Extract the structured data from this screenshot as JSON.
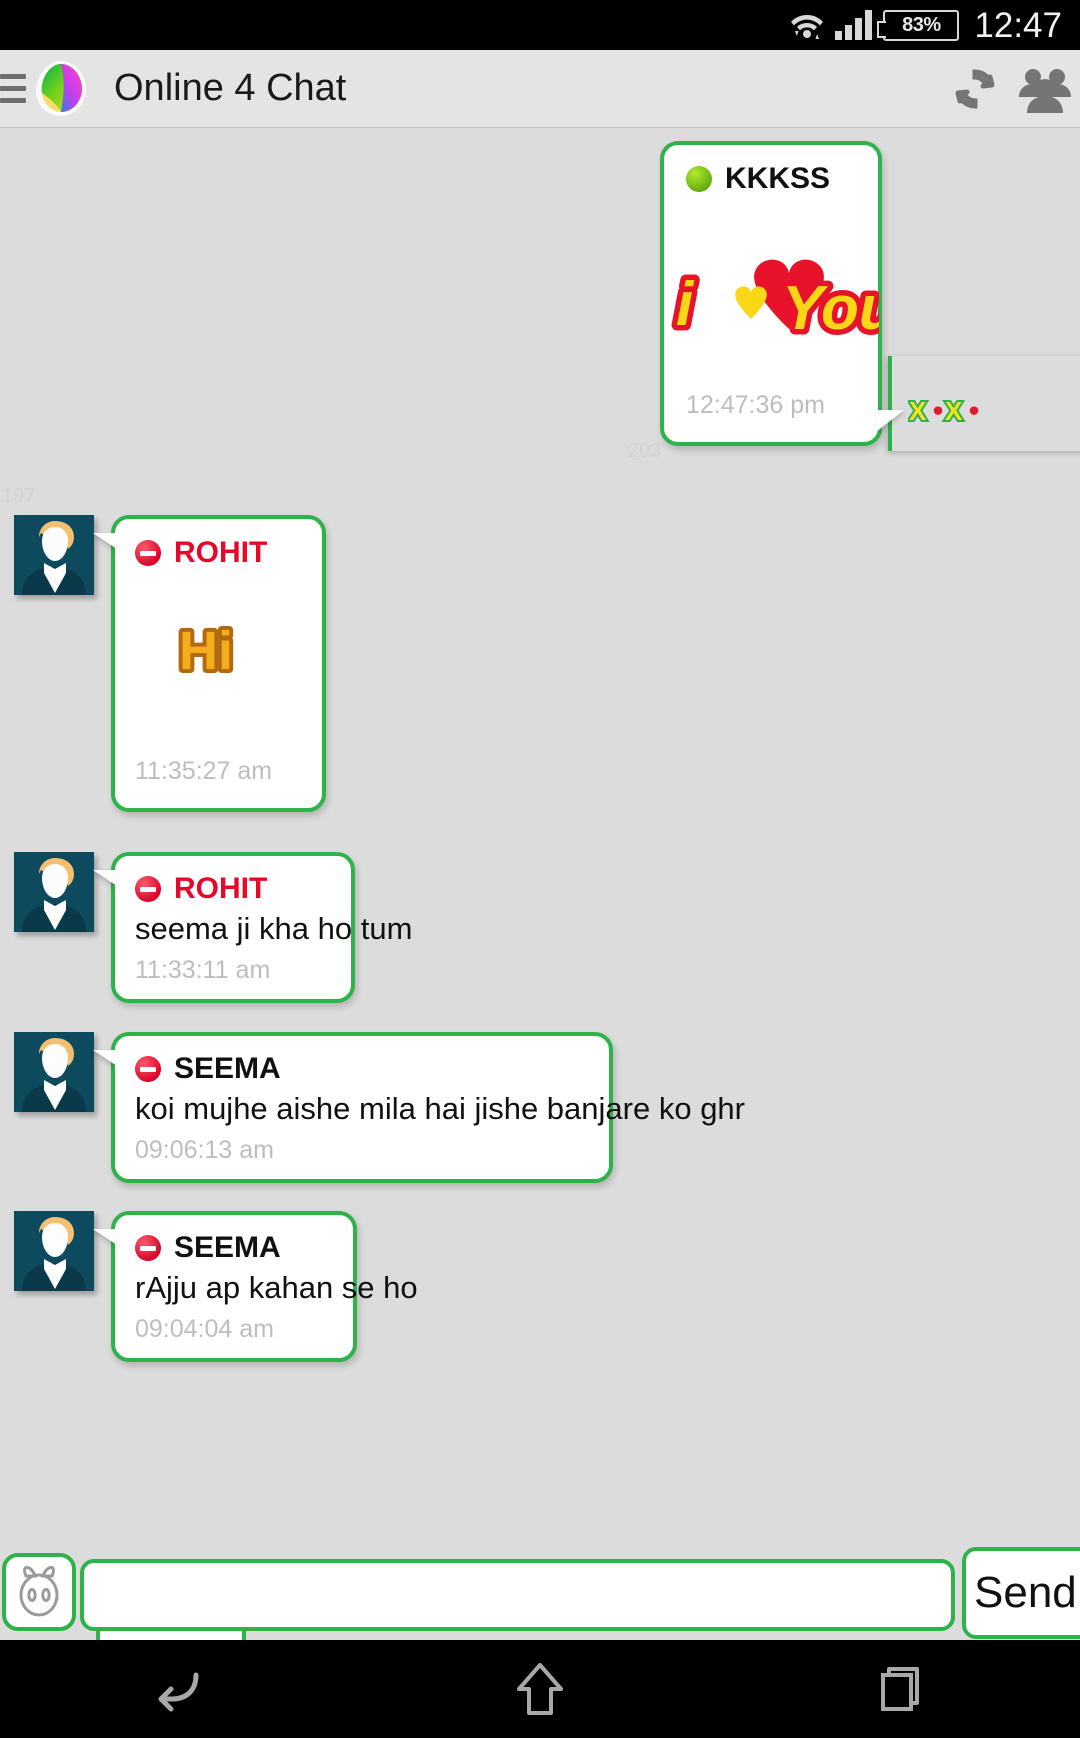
{
  "status_bar": {
    "wifi_icon": "wifi-transfer-icon",
    "signal_icon": "cellular-signal-icon",
    "battery_percent": "83%",
    "time": "12:47"
  },
  "app_bar": {
    "menu_icon": "hamburger-menu-icon",
    "logo_icon": "app-logo-icon",
    "title": "Online 4 Chat",
    "refresh_icon": "refresh-icon",
    "users_icon": "group-users-icon"
  },
  "chat": {
    "background_color": "#dcdcdc",
    "bubble_border_color": "#2db34a",
    "ghost_numbers": [
      "203",
      "197"
    ],
    "side_card": {
      "sticker": "xoxo-sticker"
    },
    "messages": [
      {
        "sender": "KKKSS",
        "align": "right",
        "presence": "online",
        "sender_color": "#111111",
        "sticker": "i-love-you-sticker",
        "sticker_text": "i ♥ You",
        "text": "",
        "time": "12:47:36 pm",
        "has_avatar": false
      },
      {
        "sender": "ROHIT",
        "align": "left",
        "presence": "offline",
        "sender_color": "#e8072b",
        "sticker": "hi-sticker",
        "sticker_text": "Hi",
        "text": "",
        "time": "11:35:27 am",
        "has_avatar": true
      },
      {
        "sender": "ROHIT",
        "align": "left",
        "presence": "offline",
        "sender_color": "#e8072b",
        "sticker": "",
        "sticker_text": "",
        "text": "seema ji kha ho tum",
        "time": "11:33:11 am",
        "has_avatar": true
      },
      {
        "sender": "SEEMA",
        "align": "left",
        "presence": "offline",
        "sender_color": "#111111",
        "sticker": "",
        "sticker_text": "",
        "text": "koi mujhe aishe mila hai jishe banjare ko ghr",
        "time": "09:06:13 am",
        "has_avatar": true
      },
      {
        "sender": "SEEMA",
        "align": "left",
        "presence": "offline",
        "sender_color": "#111111",
        "sticker": "",
        "sticker_text": "",
        "text": "rAjju ap kahan se ho",
        "time": "09:04:04 am",
        "has_avatar": true
      }
    ]
  },
  "composer": {
    "emoji_icon": "emoji-face-icon",
    "input_value": "",
    "input_placeholder": "",
    "send_label": "Send"
  },
  "nav_bar": {
    "back_icon": "back-arrow-icon",
    "home_icon": "home-icon",
    "recents_icon": "recent-apps-icon"
  }
}
